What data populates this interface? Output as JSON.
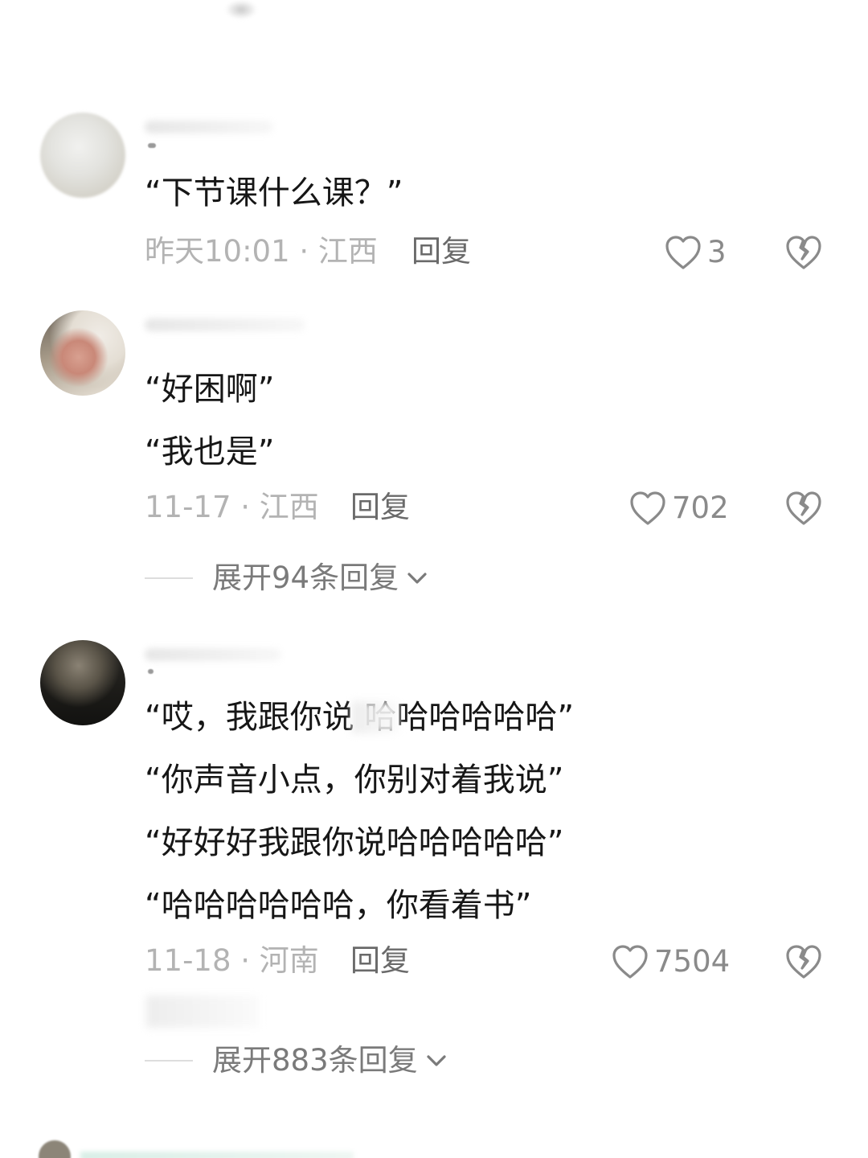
{
  "comments": [
    {
      "lines": [
        "“下节课什么课？”"
      ],
      "time_location": "昨天10:01 · 江西",
      "reply_label": "回复",
      "like_count": "3"
    },
    {
      "lines": [
        "“好困啊”",
        "“我也是”"
      ],
      "time_location": "11-17 · 江西",
      "reply_label": "回复",
      "like_count": "702",
      "expand_label": "展开94条回复"
    },
    {
      "lines": [
        "“哎，我跟你说  哈哈哈哈哈哈”",
        "“你声音小点，你别对着我说”",
        "“好好好我跟你说哈哈哈哈哈”",
        "“哈哈哈哈哈哈，你看着书”"
      ],
      "time_location": "11-18 · 河南",
      "reply_label": "回复",
      "like_count": "7504",
      "expand_label": "展开883条回复"
    }
  ],
  "icons": {
    "like": "heart-outline-icon",
    "dislike": "broken-heart-icon",
    "expand": "chevron-down-icon"
  },
  "colors": {
    "text": "#161616",
    "meta": "#b3b3b3",
    "reply": "#6a6a6a",
    "icon": "#8a8a8a",
    "background": "#ffffff"
  }
}
